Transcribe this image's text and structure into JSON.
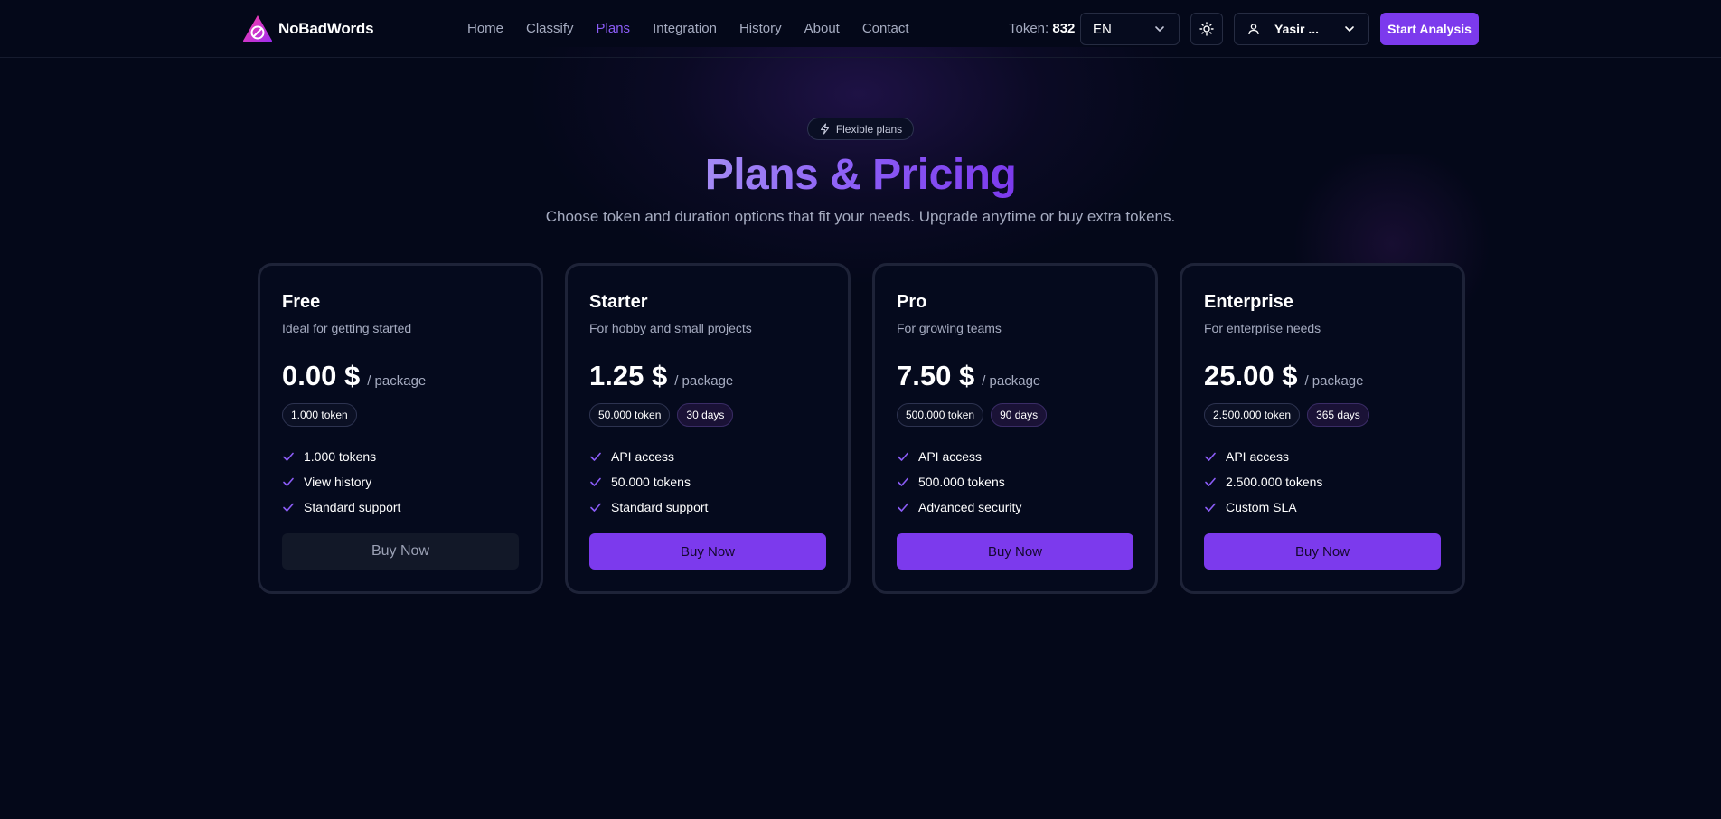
{
  "brand": {
    "name": "NoBadWords"
  },
  "nav": [
    {
      "label": "Home",
      "active": false
    },
    {
      "label": "Classify",
      "active": false
    },
    {
      "label": "Plans",
      "active": true
    },
    {
      "label": "Integration",
      "active": false
    },
    {
      "label": "History",
      "active": false
    },
    {
      "label": "About",
      "active": false
    },
    {
      "label": "Contact",
      "active": false
    }
  ],
  "token": {
    "label": "Token:",
    "value": "832"
  },
  "language": {
    "value": "EN"
  },
  "user": {
    "name": "Yasir ..."
  },
  "header": {
    "start_label": "Start Analysis"
  },
  "hero": {
    "badge": "Flexible plans",
    "title": "Plans & Pricing",
    "subtitle": "Choose token and duration options that fit your needs. Upgrade anytime or buy extra tokens."
  },
  "plans": [
    {
      "name": "Free",
      "desc": "Ideal for getting started",
      "price": "0.00 $",
      "unit": "/ package",
      "chips": [
        "1.000 token"
      ],
      "features": [
        "1.000 tokens",
        "View history",
        "Standard support"
      ],
      "button": "Buy Now"
    },
    {
      "name": "Starter",
      "desc": "For hobby and small projects",
      "price": "1.25 $",
      "unit": "/ package",
      "chips": [
        "50.000 token",
        "30 days"
      ],
      "features": [
        "API access",
        "50.000 tokens",
        "Standard support"
      ],
      "button": "Buy Now"
    },
    {
      "name": "Pro",
      "desc": "For growing teams",
      "price": "7.50 $",
      "unit": "/ package",
      "chips": [
        "500.000 token",
        "90 days"
      ],
      "features": [
        "API access",
        "500.000 tokens",
        "Advanced security"
      ],
      "button": "Buy Now"
    },
    {
      "name": "Enterprise",
      "desc": "For enterprise needs",
      "price": "25.00 $",
      "unit": "/ package",
      "chips": [
        "2.500.000 token",
        "365 days"
      ],
      "features": [
        "API access",
        "2.500.000 tokens",
        "Custom SLA"
      ],
      "button": "Buy Now"
    }
  ],
  "colors": {
    "accent": "#7c3aed",
    "background": "#040819",
    "muted_text": "#a5abc0"
  },
  "icons": {
    "brand": "circle-slash-logo-icon",
    "badge": "lightning-icon",
    "dropdown": "chevron-down-icon",
    "theme": "sun-icon",
    "user": "user-icon",
    "feature": "check-icon"
  }
}
